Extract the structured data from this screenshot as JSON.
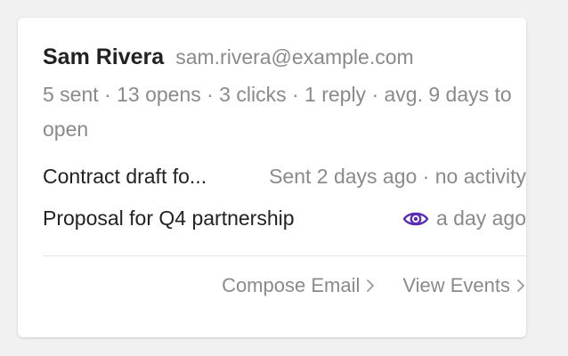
{
  "contact": {
    "name": "Sam Rivera",
    "email": "sam.rivera@example.com"
  },
  "stats_text": "5 sent · 13 opens · 3 clicks · 1 reply · avg. 9 days to open",
  "emails": [
    {
      "subject": "Contract draft fo...",
      "status": "Sent 2 days ago · no activity",
      "icon": null
    },
    {
      "subject": "Proposal for Q4 partnership",
      "status": "a day ago",
      "icon": "eye-icon"
    }
  ],
  "footer": {
    "compose_label": "Compose Email",
    "view_events_label": "View Events"
  },
  "colors": {
    "accent_icon": "#5b2db3",
    "muted_text": "#8a8a8a",
    "primary_text": "#222222"
  }
}
